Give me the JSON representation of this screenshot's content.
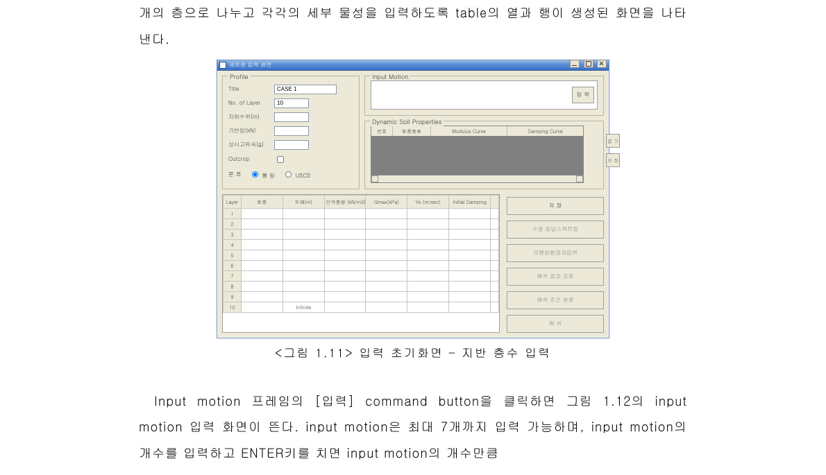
{
  "paragraph_top": "개의 층으로 나누고 각각의 세부 물성을 입력하도록 table의 열과 행이 생성된 화면을 나타낸다.",
  "caption": "<그림 1.11> 입력 초기화면 – 지반 층수 입력",
  "paragraph_bottom": "Input motion 프레임의 [입력] command button을 클릭하면 그림 1.12의 input motion 입력 화면이 뜬다. input motion은 최대 7개까지 입력 가능하며, input motion의 개수를 입력하고 ENTER키를 치면 input motion의 개수만큼",
  "dialog": {
    "title": "세로설 입력 화면",
    "profile": {
      "legend": "Profile",
      "title_label": "Title",
      "title_value": "CASE 1",
      "no_of_layer_label": "No. of Layer",
      "no_of_layer_value": "10",
      "gw_depth_label": "지하수위(m)",
      "gw_depth_value": "",
      "bedrock_unit_label": "기반암(kN)",
      "bedrock_unit_value": "",
      "accel_label": "상시고유속(g)",
      "accel_value": "",
      "outcrop_label": "Outcrop",
      "outcrop_checked": false,
      "class_label": "분 류",
      "class_opt1": "통 일",
      "class_opt2": "USCS"
    },
    "input_motion": {
      "legend": "Input Motion",
      "button": "입 력"
    },
    "dsp": {
      "legend": "Dynamic Soil Properties",
      "headers": [
        "번호",
        "토층종류",
        "Modulus Curve",
        "Damping Curve"
      ],
      "side_btn1": "열 기",
      "side_btn2": "저 장"
    },
    "layer_table": {
      "columns": [
        "Layer",
        "토층",
        "두께(m)",
        "단위중량 (kN/m3)",
        "Gmax(kPa)",
        "Vs (m/sec)",
        "Initial Damping"
      ],
      "rows": [
        "1",
        "2",
        "3",
        "4",
        "5",
        "6",
        "7",
        "8",
        "9",
        "10"
      ],
      "infinite_label": "Infinite"
    },
    "actions": {
      "save": "저  장",
      "btn2": "수정 응답스펙트럼",
      "btn3": "모델실험결과입력",
      "btn4": "해석 결과 검증",
      "btn5": "해석 조건 설정",
      "btn6": "해  석"
    }
  }
}
